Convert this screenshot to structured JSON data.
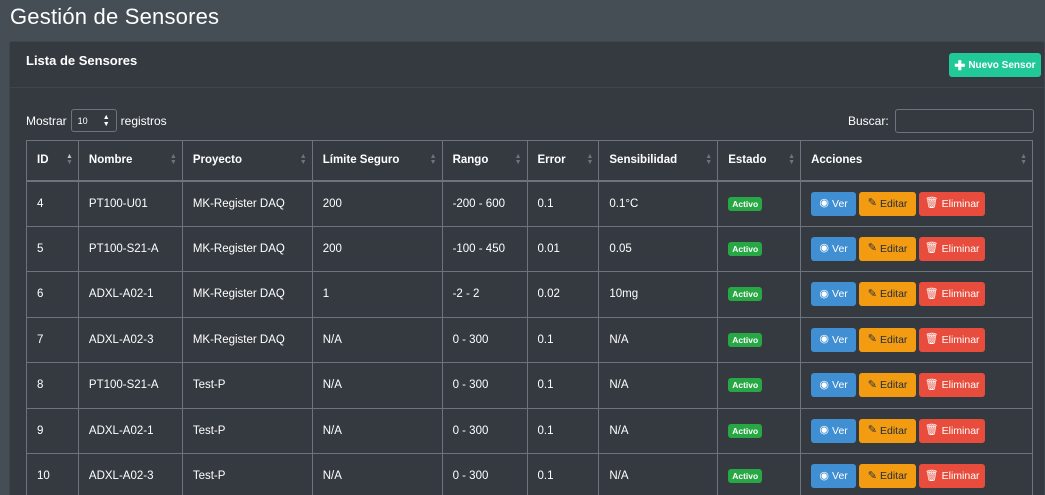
{
  "page": {
    "title": "Gestión de Sensores"
  },
  "card": {
    "title": "Lista de Sensores",
    "new_button": "Nuevo Sensor"
  },
  "length": {
    "prefix": "Mostrar",
    "value": "10",
    "suffix": "registros"
  },
  "search": {
    "label": "Buscar:",
    "value": ""
  },
  "table": {
    "headers": [
      "ID",
      "Nombre",
      "Proyecto",
      "Límite Seguro",
      "Rango",
      "Error",
      "Sensibilidad",
      "Estado",
      "Acciones"
    ],
    "rows": [
      {
        "id": "4",
        "nombre": "PT100-U01",
        "proyecto": "MK-Register DAQ",
        "limite": "200",
        "rango": "-200 - 600",
        "error": "0.1",
        "sensibilidad": "0.1°C",
        "estado": "Activo"
      },
      {
        "id": "5",
        "nombre": "PT100-S21-A",
        "proyecto": "MK-Register DAQ",
        "limite": "200",
        "rango": "-100 - 450",
        "error": "0.01",
        "sensibilidad": "0.05",
        "estado": "Activo"
      },
      {
        "id": "6",
        "nombre": "ADXL-A02-1",
        "proyecto": "MK-Register DAQ",
        "limite": "1",
        "rango": "-2 - 2",
        "error": "0.02",
        "sensibilidad": "10mg",
        "estado": "Activo"
      },
      {
        "id": "7",
        "nombre": "ADXL-A02-3",
        "proyecto": "MK-Register DAQ",
        "limite": "N/A",
        "rango": "0 - 300",
        "error": "0.1",
        "sensibilidad": "N/A",
        "estado": "Activo"
      },
      {
        "id": "8",
        "nombre": "PT100-S21-A",
        "proyecto": "Test-P",
        "limite": "N/A",
        "rango": "0 - 300",
        "error": "0.1",
        "sensibilidad": "N/A",
        "estado": "Activo"
      },
      {
        "id": "9",
        "nombre": "ADXL-A02-1",
        "proyecto": "Test-P",
        "limite": "N/A",
        "rango": "0 - 300",
        "error": "0.1",
        "sensibilidad": "N/A",
        "estado": "Activo"
      },
      {
        "id": "10",
        "nombre": "ADXL-A02-3",
        "proyecto": "Test-P",
        "limite": "N/A",
        "rango": "0 - 300",
        "error": "0.1",
        "sensibilidad": "N/A",
        "estado": "Activo"
      }
    ]
  },
  "actions": {
    "view": "Ver",
    "edit": "Editar",
    "delete": "Eliminar"
  },
  "icons": {
    "new": "plus-icon",
    "view": "eye-icon",
    "edit": "edit-icon",
    "delete": "trash-icon",
    "sort": "sort-icon"
  },
  "colors": {
    "background": "#454d55",
    "card": "#343a40",
    "new_button": "#20c997",
    "view_button": "#3f8fd2",
    "edit_button": "#f39c12",
    "delete_button": "#e74c3c",
    "badge_active": "#28a745"
  }
}
